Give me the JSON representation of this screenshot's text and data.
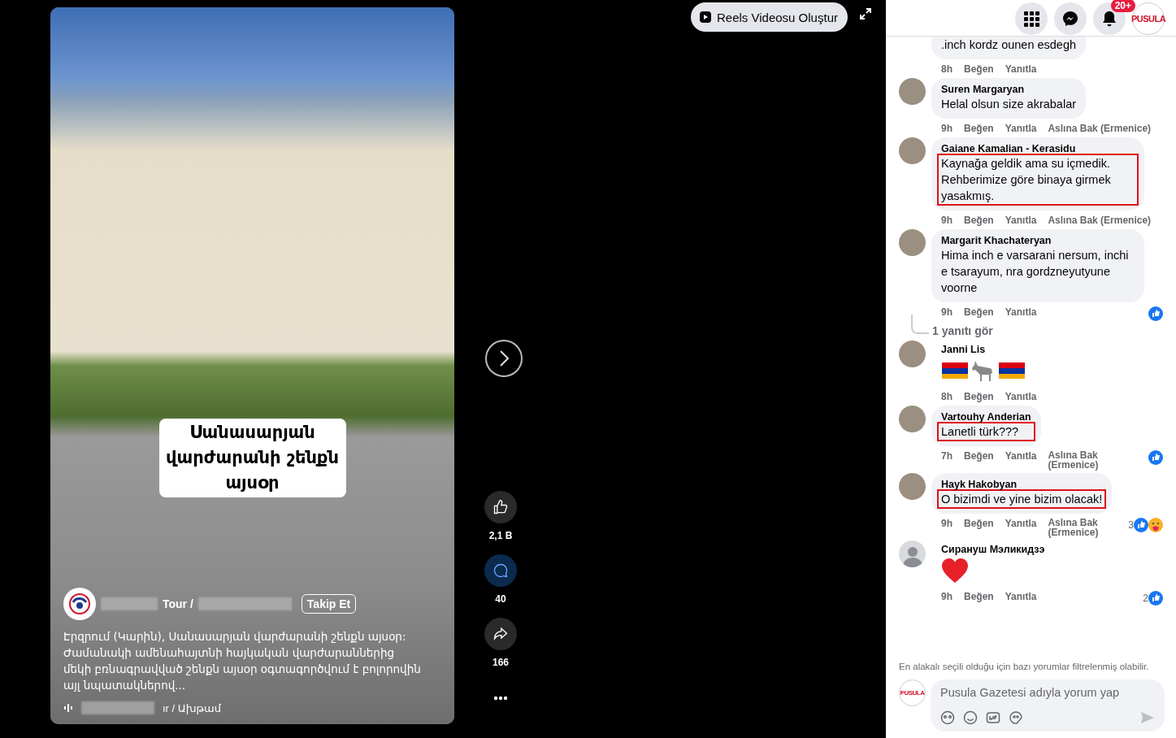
{
  "reels_button": "Reels Videosu Oluştur",
  "header": {
    "badge": "20+",
    "profile_logo": "PUSULA"
  },
  "video": {
    "caption": "Սանասարյան վարժարանի շենքն այսօր",
    "author_suffix": "Tour /",
    "follow": "Takip Et",
    "description": "Էրզրում (Կարին), Սանասարյան վարժարանի շենքն այսօր: Ժամանակի ամենահայտնի հայկական վարժարաններից մեկի բռնագրավված շենքն այսօր օգտագործվում է բոլորովին այլ նպատակներով...",
    "audio": "ır / Ախթամ"
  },
  "actions": [
    {
      "kind": "like",
      "count": "2,1 B",
      "selected": false
    },
    {
      "kind": "comment",
      "count": "40",
      "selected": true
    },
    {
      "kind": "share",
      "count": "166",
      "selected": false
    }
  ],
  "comments": [
    {
      "kind": "text",
      "text": ".inch kordz ounen esdegh",
      "time": "8h",
      "like": "Beğen",
      "reply": "Yanıtla",
      "highlighted": false
    },
    {
      "kind": "text",
      "avatar": {
        "kind": "photo"
      },
      "author": "Suren Margaryan",
      "text": "Helal olsun size akrabalar",
      "time": "9h",
      "like": "Beğen",
      "reply": "Yanıtla",
      "translate": "Aslına Bak (Ermenice)",
      "highlighted": false
    },
    {
      "kind": "text",
      "avatar": {
        "kind": "photo"
      },
      "author": "Gaiane Kamalian - Kerasidu",
      "text": "Kaynağa geldik ama su içmedik. Rehberimize göre binaya girmek yasakmış.",
      "time": "9h",
      "like": "Beğen",
      "reply": "Yanıtla",
      "translate": "Aslına Bak (Ermenice)",
      "highlighted": true
    },
    {
      "kind": "text",
      "avatar": {
        "kind": "photo"
      },
      "author": "Margarit Khachateryan",
      "text": "Hima inch e varsarani nersum, inchi e tsarayum, nra gordzneyutyune voorne",
      "time": "9h",
      "like": "Beğen",
      "reply": "Yanıtla",
      "reactions": {
        "icons": [
          {
            "kind": "like"
          }
        ]
      },
      "replies": "1 yanıtı gör",
      "highlighted": false
    },
    {
      "kind": "flags",
      "avatar": {
        "kind": "photo"
      },
      "author": "Janni Lis",
      "time": "8h",
      "like": "Beğen",
      "reply": "Yanıtla",
      "highlighted": false
    },
    {
      "kind": "text",
      "avatar": {
        "kind": "photo"
      },
      "author": "Vartouhy Anderian",
      "text": "Lanetli türk???",
      "time": "7h",
      "like": "Beğen",
      "reply": "Yanıtla",
      "translate": "Aslına Bak (Ermenice)",
      "reactions": {
        "icons": [
          {
            "kind": "like"
          }
        ]
      },
      "highlighted": true
    },
    {
      "kind": "text",
      "avatar": {
        "kind": "photo"
      },
      "author": "Hayk Hakobyan",
      "text": "O bizimdi ve yine bizim olacak!",
      "time": "9h",
      "like": "Beğen",
      "reply": "Yanıtla",
      "translate": "Aslına Bak (Ermenice)",
      "reactions": {
        "count": "3",
        "icons": [
          {
            "kind": "like"
          },
          {
            "kind": "care"
          }
        ]
      },
      "highlighted": true
    },
    {
      "kind": "heart",
      "avatar": {
        "kind": "default"
      },
      "author": "Сирануш Мэликидзэ",
      "time": "9h",
      "like": "Beğen",
      "reply": "Yanıtla",
      "reactions": {
        "count": "2",
        "icons": [
          {
            "kind": "like"
          }
        ]
      },
      "highlighted": false
    }
  ],
  "filter_note": "En alakalı seçili olduğu için bazı yorumlar filtrelenmiş olabilir.",
  "composer": {
    "avatar_logo": "PUSULA",
    "placeholder": "Pusula Gazetesi adıyla yorum yap"
  }
}
